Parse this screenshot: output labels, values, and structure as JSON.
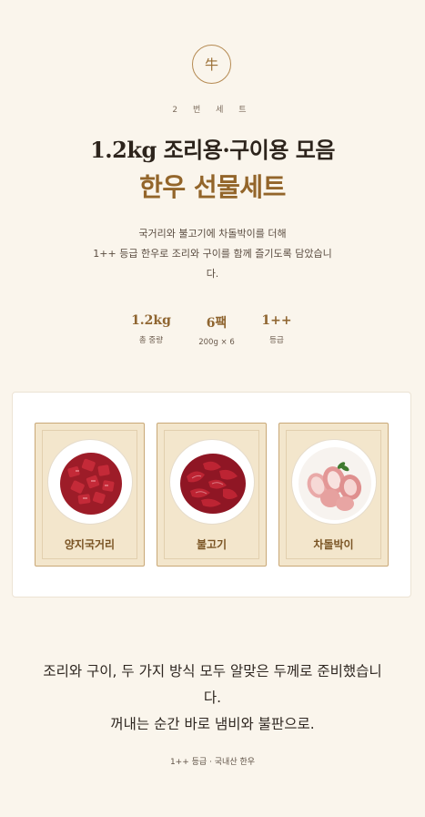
{
  "emblem": {
    "char": "牛"
  },
  "set_label": "2 번 세 트",
  "title": {
    "line1": "1.2kg 조리용·구이용 모음",
    "line2": "한우 선물세트"
  },
  "description": {
    "line1": "국거리와 불고기에 차돌박이를 더해",
    "line2": "1++ 등급 한우로 조리와 구이를 함께 즐기도록 담았습니",
    "line3": "다."
  },
  "stats": [
    {
      "value": "1.2kg",
      "label": "총 중량"
    },
    {
      "value": "6팩",
      "label": "200g × 6"
    },
    {
      "value": "1++",
      "label": "등급"
    }
  ],
  "products": [
    {
      "name": "양지국거리",
      "image": "beef-cubes-photo"
    },
    {
      "name": "불고기",
      "image": "bulgogi-slices-photo"
    },
    {
      "name": "차돌박이",
      "image": "brisket-rolls-photo"
    }
  ],
  "tagline": {
    "line1": "조리와 구이, 두 가지 방식 모두 알맞은 두께로 준비했습니",
    "line2": "다.",
    "line3": "꺼내는 순간 바로 냄비와 불판으로."
  },
  "footer": "1++ 등급 · 국내산 한우",
  "colors": {
    "background": "#faf5ec",
    "accent_gold": "#93652a",
    "card_beige": "#f3e6cc",
    "meat_red": "#a8202c"
  }
}
